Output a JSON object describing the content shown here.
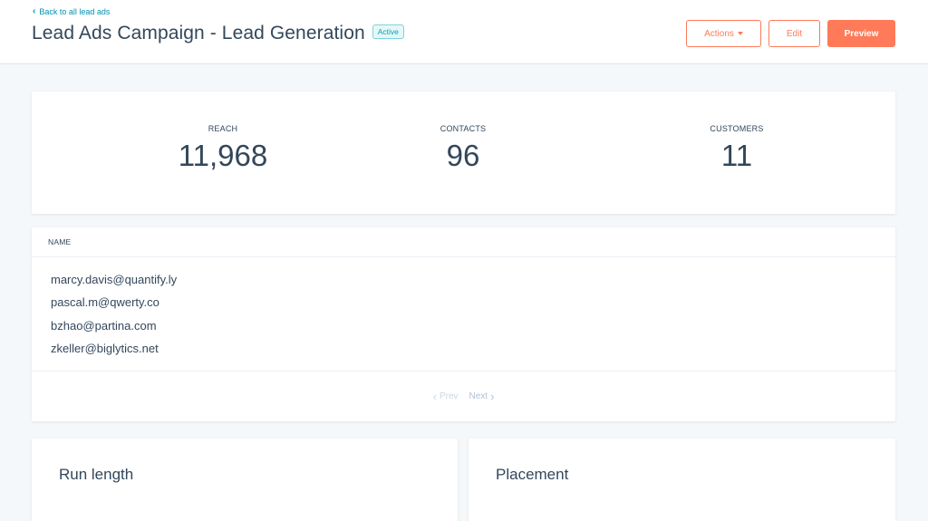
{
  "header": {
    "back_link": "Back to all lead ads",
    "title": "Lead Ads Campaign - Lead Generation",
    "status": "Active"
  },
  "actions": {
    "actions_label": "Actions",
    "edit_label": "Edit",
    "preview_label": "Preview"
  },
  "stats": [
    {
      "label": "REACH",
      "value": "11,968"
    },
    {
      "label": "CONTACTS",
      "value": "96"
    },
    {
      "label": "CUSTOMERS",
      "value": "11"
    }
  ],
  "contacts_table": {
    "column_header": "NAME",
    "rows": [
      "marcy.davis@quantify.ly",
      "pascal.m@qwerty.co",
      "bzhao@partina.com",
      "zkeller@biglytics.net"
    ],
    "prev_label": "Prev",
    "next_label": "Next"
  },
  "sections": {
    "run_length": "Run length",
    "placement": "Placement"
  },
  "colors": {
    "accent": "#ff7a59",
    "link": "#0091ae",
    "text": "#33475b",
    "background": "#f5f8fa"
  },
  "icons": {
    "back": "chevron-left-icon",
    "actions_dropdown": "caret-down-icon",
    "prev": "chevron-left-icon",
    "next": "chevron-right-icon"
  }
}
